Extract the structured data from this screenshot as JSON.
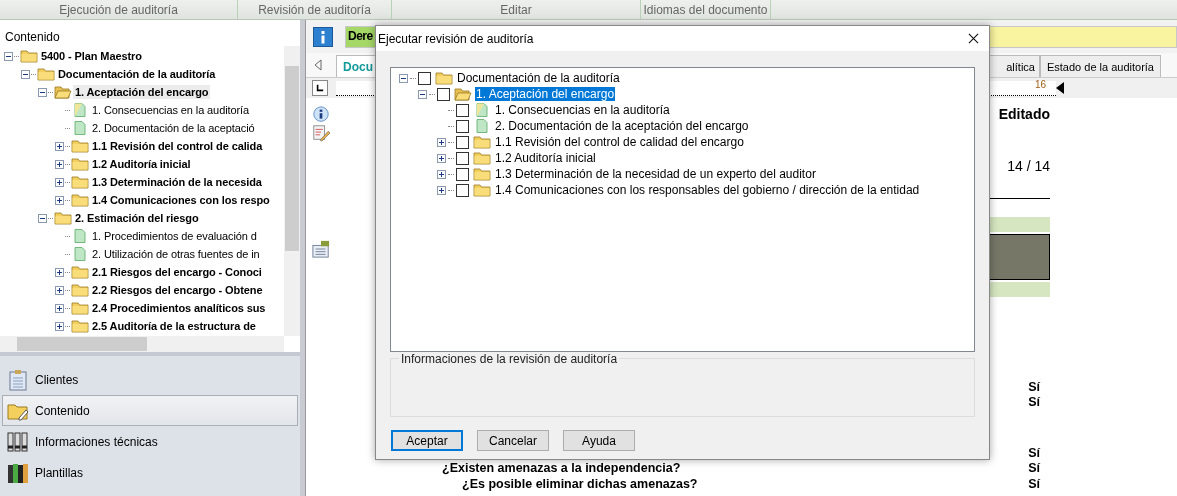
{
  "ribbon": {
    "groups": [
      "Ejecución de auditoría",
      "Revisión de auditoría",
      "Editar",
      "Idiomas del documento"
    ]
  },
  "sidebar": {
    "title": "Contenido",
    "tree": [
      {
        "label": "5400 - Plan Maestro",
        "kind": "folder",
        "selected": false,
        "expanded": true,
        "children": [
          {
            "label": "Documentación de la auditoría",
            "kind": "folder",
            "selected": false,
            "expanded": true,
            "children": [
              {
                "label": "1. Aceptación del encargo",
                "kind": "open-folder",
                "selected": true,
                "expanded": true,
                "children": [
                  {
                    "label": "1. Consecuencias en la auditoría",
                    "kind": "document-edited",
                    "selected": false
                  },
                  {
                    "label": "2. Documentación de la aceptació",
                    "kind": "document",
                    "selected": false
                  },
                  {
                    "label": "1.1 Revisión del control de calida",
                    "kind": "folder",
                    "selected": false,
                    "expanded": false
                  },
                  {
                    "label": "1.2 Auditoría inicial",
                    "kind": "folder",
                    "selected": false,
                    "expanded": false
                  },
                  {
                    "label": "1.3 Determinación de la necesida",
                    "kind": "folder",
                    "selected": false,
                    "expanded": false
                  },
                  {
                    "label": "1.4 Comunicaciones con los respo",
                    "kind": "folder",
                    "selected": false,
                    "expanded": false
                  }
                ]
              },
              {
                "label": "2. Estimación del riesgo",
                "kind": "folder",
                "selected": false,
                "expanded": true,
                "children": [
                  {
                    "label": "1. Procedimientos de evaluación d",
                    "kind": "document",
                    "selected": false
                  },
                  {
                    "label": "2. Utilización de otras fuentes de in",
                    "kind": "document",
                    "selected": false
                  },
                  {
                    "label": "2.1 Riesgos del encargo - Conoci",
                    "kind": "folder",
                    "selected": false,
                    "expanded": false
                  },
                  {
                    "label": "2.2 Riesgos del encargo - Obtene",
                    "kind": "folder",
                    "selected": false,
                    "expanded": false
                  },
                  {
                    "label": "2.4 Procedimientos analíticos sus",
                    "kind": "folder",
                    "selected": false,
                    "expanded": false
                  },
                  {
                    "label": "2.5 Auditoría de la estructura de",
                    "kind": "folder",
                    "selected": false,
                    "expanded": false
                  }
                ]
              }
            ]
          }
        ]
      }
    ],
    "nav": [
      {
        "label": "Clientes",
        "kind": "clipboard",
        "selected": false
      },
      {
        "label": "Contenido",
        "kind": "folder",
        "selected": true
      },
      {
        "label": "Informaciones técnicas",
        "kind": "binders",
        "selected": false
      },
      {
        "label": "Plantillas",
        "kind": "books",
        "selected": false
      }
    ]
  },
  "document": {
    "banner": "Dere",
    "tabs": [
      {
        "label": "Docu",
        "selected": true
      },
      {
        "label": "alítica",
        "selected": false
      },
      {
        "label": "Estado de la auditoría",
        "selected": false
      }
    ],
    "ruler_mark": "16",
    "status": "Editado",
    "pages": "14 / 14",
    "rows": [
      {
        "answer": "Sí"
      },
      {
        "answer": "Sí"
      },
      {
        "answer": "Sí"
      },
      {
        "question": "¿Existen amenazas a la independencia?",
        "answer": "Sí",
        "children": [
          {
            "question": "¿Es posible eliminar dichas amenazas?",
            "answer": "Sí"
          }
        ]
      }
    ]
  },
  "dialog": {
    "title": "Ejecutar revisión de auditoría",
    "tree": [
      {
        "label": "Documentación de la auditoría",
        "kind": "folder",
        "checked": false,
        "selected": false,
        "expanded": true,
        "children": [
          {
            "label": "1. Aceptación del encargo",
            "kind": "open-folder",
            "checked": false,
            "selected": true,
            "expanded": true,
            "children": [
              {
                "label": "1. Consecuencias en la auditoría",
                "kind": "document-edited",
                "checked": false,
                "selected": false
              },
              {
                "label": "2. Documentación de la aceptación del encargo",
                "kind": "document",
                "checked": false,
                "selected": false
              },
              {
                "label": "1.1 Revisión del control de calidad del encargo",
                "kind": "folder",
                "checked": false,
                "selected": false,
                "expanded": false
              },
              {
                "label": "1.2 Auditoría inicial",
                "kind": "folder",
                "checked": false,
                "selected": false,
                "expanded": false
              },
              {
                "label": "1.3 Determinación de la necesidad de un experto del auditor",
                "kind": "folder",
                "checked": false,
                "selected": false,
                "expanded": false
              },
              {
                "label": "1.4 Comunicaciones con los responsables del gobierno / dirección de la entidad",
                "kind": "folder",
                "checked": false,
                "selected": false,
                "expanded": false
              }
            ]
          }
        ]
      }
    ],
    "info_group": "Informaciones de la revisión de auditoría",
    "buttons": [
      {
        "label": "Aceptar",
        "selected": true
      },
      {
        "label": "Cancelar",
        "selected": false
      },
      {
        "label": "Ayuda",
        "selected": false
      }
    ]
  }
}
